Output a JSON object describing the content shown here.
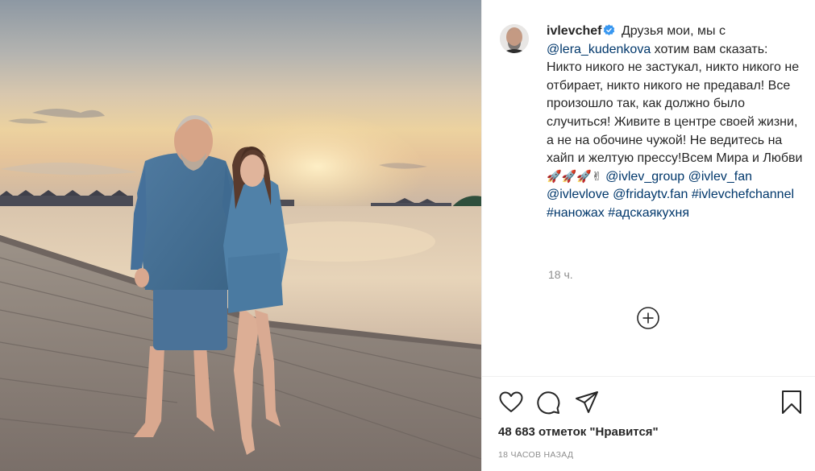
{
  "post": {
    "username": "ivlevchef",
    "caption_text": "Друзья мои, мы с",
    "caption_mention": "@lera_kudenkova",
    "caption_body": "хотим вам сказать: Никто никого не застукал, никто никого не отбирает, никто никого не предавал! Все произошло так, как должно было случиться! Живите в центре своей жизни, а не на обочине чужой! Не ведитесь на хайп и желтую прессу!Всем Мира и Любви",
    "caption_emoji": "🚀🚀🚀✌",
    "tags": [
      "@ivlev_group",
      "@ivlev_fan",
      "@ivlevlove",
      "@fridaytv.fan",
      "#ivlevchefchannel",
      "#наножах",
      "#адскаякухня"
    ],
    "time_ago": "18 ч.",
    "likes": "48 683 отметок \"Нравится\"",
    "date": "18 ЧАСОВ НАЗАД"
  },
  "icons": {
    "verified": "verified-badge-icon",
    "load_more": "plus-circle-icon",
    "like": "heart-icon",
    "comment": "comment-icon",
    "share": "paper-plane-icon",
    "save": "bookmark-icon"
  },
  "colors": {
    "link": "#00376b",
    "text": "#262626",
    "muted": "#8e8e8e",
    "verified": "#3897f0"
  }
}
